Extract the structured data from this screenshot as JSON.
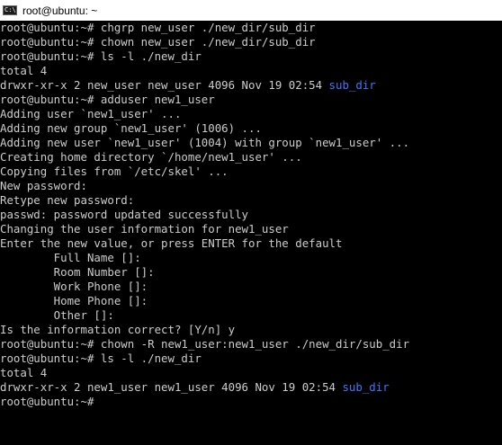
{
  "window": {
    "title": "root@ubuntu: ~",
    "icon": "terminal-icon",
    "icon_glyph": "C:\\"
  },
  "colors": {
    "background": "#000000",
    "text": "#cccccc",
    "directory": "#3b78ff"
  },
  "terminal": {
    "lines": [
      {
        "text": "root@ubuntu:~# chgrp new_user ./new_dir/sub_dir"
      },
      {
        "text": "root@ubuntu:~# chown new_user ./new_dir/sub_dir"
      },
      {
        "text": "root@ubuntu:~# ls -l ./new_dir"
      },
      {
        "text": "total 4"
      },
      {
        "text": "drwxr-xr-x 2 new_user new_user 4096 Nov 19 02:54 ",
        "highlight": "sub_dir"
      },
      {
        "text": "root@ubuntu:~# adduser new1_user"
      },
      {
        "text": "Adding user `new1_user' ..."
      },
      {
        "text": "Adding new group `new1_user' (1006) ..."
      },
      {
        "text": "Adding new user `new1_user' (1004) with group `new1_user' ..."
      },
      {
        "text": "Creating home directory `/home/new1_user' ..."
      },
      {
        "text": "Copying files from `/etc/skel' ..."
      },
      {
        "text": "New password:"
      },
      {
        "text": "Retype new password:"
      },
      {
        "text": "passwd: password updated successfully"
      },
      {
        "text": "Changing the user information for new1_user"
      },
      {
        "text": "Enter the new value, or press ENTER for the default"
      },
      {
        "text": "        Full Name []:"
      },
      {
        "text": "        Room Number []:"
      },
      {
        "text": "        Work Phone []:"
      },
      {
        "text": "        Home Phone []:"
      },
      {
        "text": "        Other []:"
      },
      {
        "text": "Is the information correct? [Y/n] y"
      },
      {
        "text": "root@ubuntu:~# chown -R new1_user:new1_user ./new_dir/sub_dir"
      },
      {
        "text": "root@ubuntu:~# ls -l ./new_dir"
      },
      {
        "text": "total 4"
      },
      {
        "text": "drwxr-xr-x 2 new1_user new1_user 4096 Nov 19 02:54 ",
        "highlight": "sub_dir"
      },
      {
        "text": "root@ubuntu:~#"
      }
    ]
  }
}
